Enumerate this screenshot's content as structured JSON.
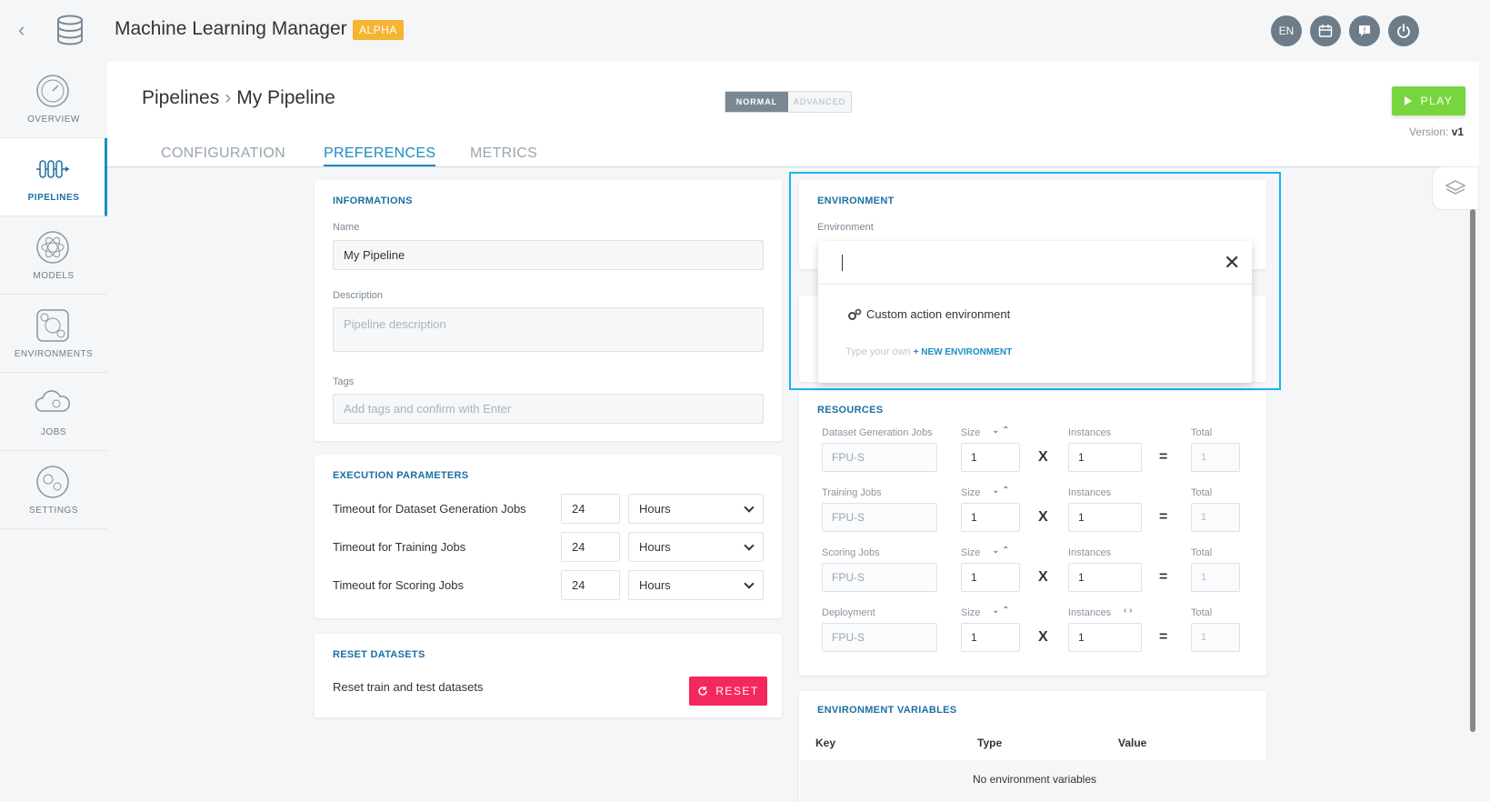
{
  "app": {
    "title": "Machine Learning Manager",
    "badge": "ALPHA",
    "top_buttons": [
      {
        "label": "EN",
        "icon": "language-icon"
      },
      {
        "label": "",
        "icon": "calendar-icon"
      },
      {
        "label": "",
        "icon": "help-chat-icon"
      },
      {
        "label": "",
        "icon": "power-icon"
      }
    ]
  },
  "sidebar": {
    "items": [
      {
        "label": "OVERVIEW",
        "active": false
      },
      {
        "label": "PIPELINES",
        "active": true
      },
      {
        "label": "MODELS",
        "active": false
      },
      {
        "label": "ENVIRONMENTS",
        "active": false
      },
      {
        "label": "JOBS",
        "active": false
      },
      {
        "label": "SETTINGS",
        "active": false
      }
    ]
  },
  "header": {
    "breadcrumb_root": "Pipelines",
    "breadcrumb_current": "My Pipeline",
    "mode_normal": "NORMAL",
    "mode_advanced": "ADVANCED",
    "play_label": "PLAY",
    "version_label": "Version:",
    "version_value": "v1"
  },
  "tabs": [
    {
      "label": "CONFIGURATION",
      "active": false
    },
    {
      "label": "PREFERENCES",
      "active": true
    },
    {
      "label": "METRICS",
      "active": false
    }
  ],
  "informations": {
    "title": "INFORMATIONS",
    "name_label": "Name",
    "name_value": "My Pipeline",
    "description_label": "Description",
    "description_placeholder": "Pipeline description",
    "tags_label": "Tags",
    "tags_placeholder": "Add tags and confirm with Enter"
  },
  "execution": {
    "title": "EXECUTION PARAMETERS",
    "rows": [
      {
        "label": "Timeout for Dataset Generation Jobs",
        "value": "24",
        "unit": "Hours"
      },
      {
        "label": "Timeout for Training Jobs",
        "value": "24",
        "unit": "Hours"
      },
      {
        "label": "Timeout for Scoring Jobs",
        "value": "24",
        "unit": "Hours"
      }
    ]
  },
  "reset": {
    "title": "RESET DATASETS",
    "label": "Reset train and test datasets",
    "button": "RESET"
  },
  "environment": {
    "title": "ENVIRONMENT",
    "label": "Environment",
    "search_value": "",
    "option": "Custom action environment",
    "own_hint": "Type your own",
    "new_label": "+ NEW ENVIRONMENT"
  },
  "resources": {
    "title": "RESOURCES",
    "size_header": "Size",
    "instances_header": "Instances",
    "total_header": "Total",
    "multiply": "X",
    "equals": "=",
    "rows": [
      {
        "label": "Dataset Generation Jobs",
        "type": "FPU-S",
        "size": "1",
        "instances": "1",
        "total": "1"
      },
      {
        "label": "Training Jobs",
        "type": "FPU-S",
        "size": "1",
        "instances": "1",
        "total": "1"
      },
      {
        "label": "Scoring Jobs",
        "type": "FPU-S",
        "size": "1",
        "instances": "1",
        "total": "1"
      },
      {
        "label": "Deployment",
        "type": "FPU-S",
        "size": "1",
        "instances": "1",
        "total": "1"
      }
    ]
  },
  "env_vars": {
    "title": "ENVIRONMENT VARIABLES",
    "col_key": "Key",
    "col_type": "Type",
    "col_value": "Value",
    "empty": "No environment variables"
  },
  "colors": {
    "accent": "#1b8cc4",
    "play": "#77d63d",
    "reset": "#f5285e",
    "alpha": "#f5b432",
    "highlight": "#1cb4ea"
  }
}
